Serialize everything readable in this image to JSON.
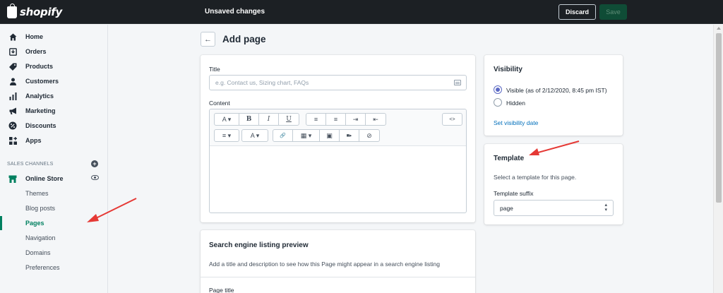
{
  "topbar": {
    "logo_text": "shopify",
    "status": "Unsaved changes",
    "discard_label": "Discard",
    "save_label": "Save"
  },
  "sidebar": {
    "items": [
      {
        "label": "Home",
        "icon": "home-icon"
      },
      {
        "label": "Orders",
        "icon": "orders-icon"
      },
      {
        "label": "Products",
        "icon": "tag-icon"
      },
      {
        "label": "Customers",
        "icon": "person-icon"
      },
      {
        "label": "Analytics",
        "icon": "bar-chart-icon"
      },
      {
        "label": "Marketing",
        "icon": "megaphone-icon"
      },
      {
        "label": "Discounts",
        "icon": "discount-icon"
      },
      {
        "label": "Apps",
        "icon": "apps-icon"
      }
    ],
    "channels_title": "SALES CHANNELS",
    "online_store": "Online Store",
    "sub_items": [
      "Themes",
      "Blog posts",
      "Pages",
      "Navigation",
      "Domains",
      "Preferences"
    ],
    "active_sub_item": "Pages"
  },
  "page": {
    "title": "Add page",
    "title_field_label": "Title",
    "title_placeholder": "e.g. Contact us, Sizing chart, FAQs",
    "content_label": "Content",
    "toolbar_row1": [
      "A ▾",
      "B",
      "I",
      "U",
      "≡",
      "≡",
      "⇥",
      "⇤",
      "<>"
    ],
    "toolbar_row2": [
      "≡ ▾",
      "A ▾",
      "🔗",
      "▦ ▾",
      "▣",
      "■▸",
      "⊘"
    ]
  },
  "seo": {
    "title": "Search engine listing preview",
    "description": "Add a title and description to see how this Page might appear in a search engine listing",
    "page_title_label": "Page title"
  },
  "visibility": {
    "title": "Visibility",
    "visible_label": "Visible (as of 2/12/2020, 8:45 pm IST)",
    "hidden_label": "Hidden",
    "set_date_link": "Set visibility date"
  },
  "template": {
    "title": "Template",
    "description": "Select a template for this page.",
    "suffix_label": "Template suffix",
    "suffix_value": "page"
  },
  "colors": {
    "topbar": "#1c2024",
    "accent_green": "#008060",
    "radio": "#5c6ac4",
    "link": "#006fbb",
    "annotation_arrow": "#e53935"
  }
}
